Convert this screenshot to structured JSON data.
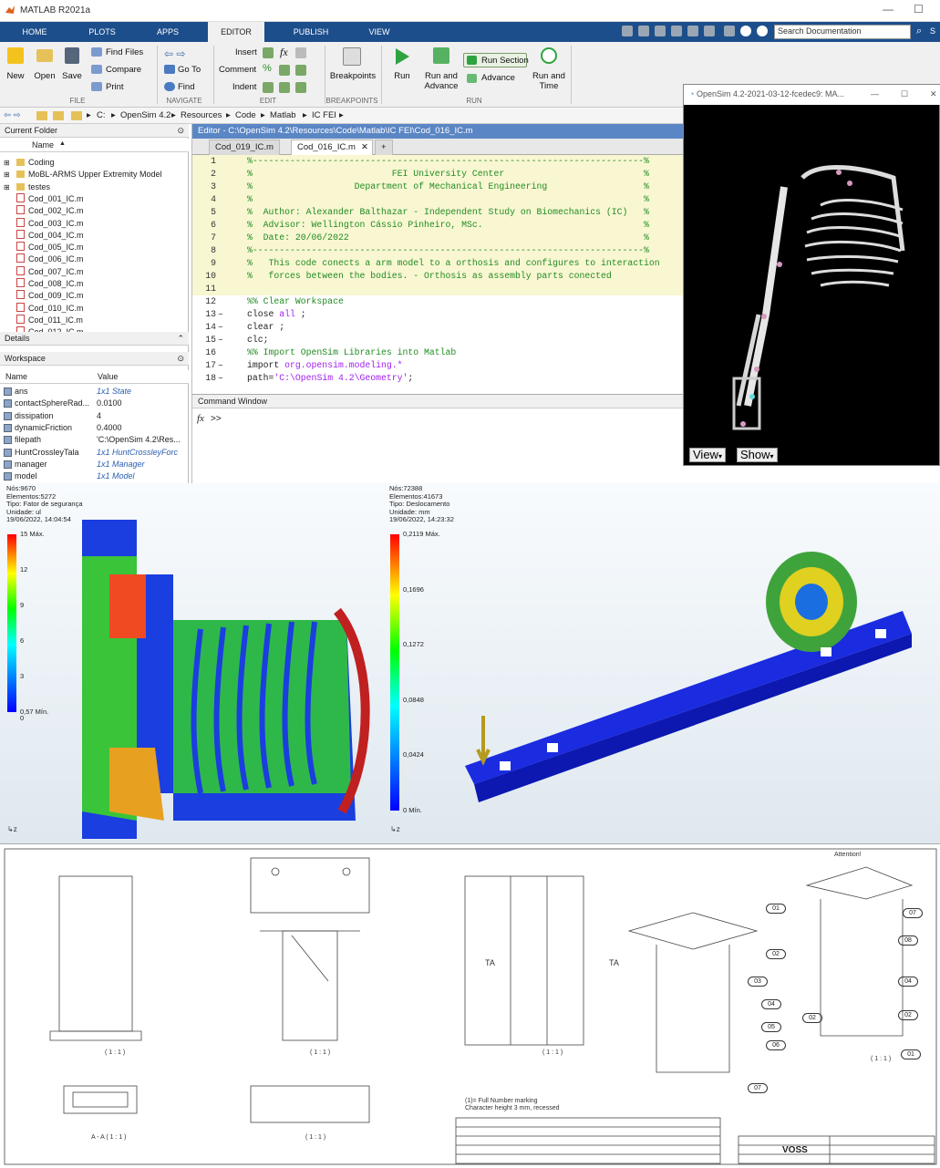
{
  "titlebar": {
    "title": "MATLAB R2021a"
  },
  "tabs": [
    "HOME",
    "PLOTS",
    "APPS",
    "EDITOR",
    "PUBLISH",
    "VIEW"
  ],
  "search": {
    "placeholder": "Search Documentation",
    "user_initial": "S"
  },
  "ribbon": {
    "file": {
      "new": "New",
      "open": "Open",
      "save": "Save",
      "find_files": "Find Files",
      "compare": "Compare",
      "print": "Print",
      "group": "FILE"
    },
    "navigate": {
      "goto": "Go To",
      "find": "Find",
      "group": "NAVIGATE"
    },
    "edit": {
      "insert": "Insert",
      "comment": "Comment",
      "indent": "Indent",
      "group": "EDIT",
      "fx": "fx"
    },
    "breakpoints": {
      "label": "Breakpoints",
      "group": "BREAKPOINTS"
    },
    "run": {
      "run": "Run",
      "run_advance": "Run and\nAdvance",
      "run_section": "Run Section",
      "advance": "Advance",
      "run_time": "Run and\nTime",
      "group": "RUN"
    }
  },
  "address": [
    "C:",
    "OpenSim 4.2",
    "Resources",
    "Code",
    "Matlab",
    "IC FEI"
  ],
  "current_folder": {
    "title": "Current Folder",
    "col_name": "Name",
    "items": [
      {
        "name": "Coding",
        "type": "folder"
      },
      {
        "name": "MoBL-ARMS Upper Extremity Model",
        "type": "folder"
      },
      {
        "name": "testes",
        "type": "folder"
      },
      {
        "name": "Cod_001_IC.m",
        "type": "file"
      },
      {
        "name": "Cod_002_IC.m",
        "type": "file"
      },
      {
        "name": "Cod_003_IC.m",
        "type": "file"
      },
      {
        "name": "Cod_004_IC.m",
        "type": "file"
      },
      {
        "name": "Cod_005_IC.m",
        "type": "file"
      },
      {
        "name": "Cod_006_IC.m",
        "type": "file"
      },
      {
        "name": "Cod_007_IC.m",
        "type": "file"
      },
      {
        "name": "Cod_008_IC.m",
        "type": "file"
      },
      {
        "name": "Cod_009_IC.m",
        "type": "file"
      },
      {
        "name": "Cod_010_IC.m",
        "type": "file"
      },
      {
        "name": "Cod_011_IC.m",
        "type": "file"
      },
      {
        "name": "Cod_012_IC.m",
        "type": "file"
      }
    ]
  },
  "details": {
    "title": "Details"
  },
  "workspace": {
    "title": "Workspace",
    "col_name": "Name",
    "col_value": "Value",
    "rows": [
      {
        "name": "ans",
        "value": "1x1 State",
        "italic": true
      },
      {
        "name": "contactSphereRad...",
        "value": "0.0100",
        "italic": false
      },
      {
        "name": "dissipation",
        "value": "4",
        "italic": false
      },
      {
        "name": "dynamicFriction",
        "value": "0.4000",
        "italic": false
      },
      {
        "name": "filepath",
        "value": "'C:\\OpenSim 4.2\\Res...",
        "italic": false
      },
      {
        "name": "HuntCrossleyTala",
        "value": "1x1 HuntCrossleyForc",
        "italic": true
      },
      {
        "name": "manager",
        "value": "1x1 Manager",
        "italic": true
      },
      {
        "name": "model",
        "value": "1x1 Model",
        "italic": true
      }
    ]
  },
  "editor": {
    "header": "Editor - C:\\OpenSim 4.2\\Resources\\Code\\Matlab\\IC FEI\\Cod_016_IC.m",
    "tabs": [
      "Cod_019_IC.m",
      "Cod_016_IC.m"
    ],
    "add_tab": "+",
    "lines": [
      {
        "n": "1",
        "t": "%-------------------------------------------------------------------------%",
        "c": "cm",
        "cell": true
      },
      {
        "n": "2",
        "t": "%                          FEI University Center                          %",
        "c": "cm",
        "cell": true
      },
      {
        "n": "3",
        "t": "%                   Department of Mechanical Engineering                  %",
        "c": "cm",
        "cell": true
      },
      {
        "n": "4",
        "t": "%                                                                         %",
        "c": "cm",
        "cell": true
      },
      {
        "n": "5",
        "t": "%  Author: Alexander Balthazar - Independent Study on Biomechanics (IC)   %",
        "c": "cm",
        "cell": true
      },
      {
        "n": "6",
        "t": "%  Advisor: Wellington Cássio Pinheiro, MSc.                              %",
        "c": "cm",
        "cell": true
      },
      {
        "n": "7",
        "t": "%  Date: 20/06/2022                                                       %",
        "c": "cm",
        "cell": true
      },
      {
        "n": "8",
        "t": "%-------------------------------------------------------------------------%",
        "c": "cm",
        "cell": true
      },
      {
        "n": "9",
        "t": "%   This code conects a arm model to a orthosis and configures to interaction",
        "c": "cm",
        "cell": true
      },
      {
        "n": "10",
        "t": "%   forces between the bodies. - Orthosis as assembly parts conected",
        "c": "cm",
        "cell": true
      },
      {
        "n": "11",
        "t": "",
        "c": "",
        "cell": true
      },
      {
        "n": "12",
        "t": "%% Clear Workspace",
        "c": "cm",
        "cell": false
      },
      {
        "n": "13",
        "t": "close all ;",
        "c": "",
        "cell": false,
        "dash": true
      },
      {
        "n": "14",
        "t": "clear ;",
        "c": "",
        "cell": false,
        "dash": true
      },
      {
        "n": "15",
        "t": "clc;",
        "c": "",
        "cell": false,
        "dash": true
      },
      {
        "n": "16",
        "t": "%% Import OpenSim Libraries into Matlab",
        "c": "cm",
        "cell": false
      },
      {
        "n": "17",
        "t": "import org.opensim.modeling.*",
        "c": "",
        "cell": false,
        "dash": true
      },
      {
        "n": "18",
        "t": "path='C:\\OpenSim 4.2\\Geometry';",
        "c": "",
        "cell": false,
        "dash": true
      }
    ]
  },
  "command_window": {
    "title": "Command Window",
    "prompt": ">>",
    "fx": "fx"
  },
  "opensim": {
    "title": "OpenSim 4.2-2021-03-12-fcedec9: MA...",
    "view_btn": "View",
    "show_btn": "Show"
  },
  "fea_left": {
    "header": [
      "Nós:9670",
      "Elementos:5272",
      "Tipo: Fator de segurança",
      "Unidade: ul",
      "19/06/2022, 14:04:54"
    ],
    "legend": [
      "15 Máx.",
      "12",
      "9",
      "6",
      "3",
      "0,57 Mín.",
      "0"
    ]
  },
  "fea_right": {
    "header": [
      "Nós:72388",
      "Elementos:41673",
      "Tipo: Deslocamento",
      "Unidade: mm",
      "19/06/2022, 14:23:32"
    ],
    "legend": [
      "0,2119 Máx.",
      "0,1696",
      "0,1272",
      "0,0848",
      "0,0424",
      "0 Mín."
    ]
  },
  "drawing": {
    "section_labels": [
      "( 1 : 1 )",
      "( 1 : 1 )",
      "( 1 : 1 )",
      "( 1 : 1 )",
      "A - A  ( 1 : 1 )",
      "( 1 : 1 )"
    ],
    "callouts": [
      "01",
      "02",
      "03",
      "04",
      "05",
      "06",
      "07",
      "07",
      "08",
      "04",
      "02",
      "02",
      "01"
    ],
    "dims": [
      "TA",
      "TA"
    ],
    "notes": [
      "Attention!",
      "(1)= Full Number marking",
      "Character height 3 mm, recessed"
    ],
    "brand": "VOSS"
  },
  "colors": {
    "ribbon_tab_bg": "#1c4e8b",
    "editor_header": "#5b86c5",
    "cell_bg": "#f8f7d2",
    "comment": "#228b22"
  }
}
